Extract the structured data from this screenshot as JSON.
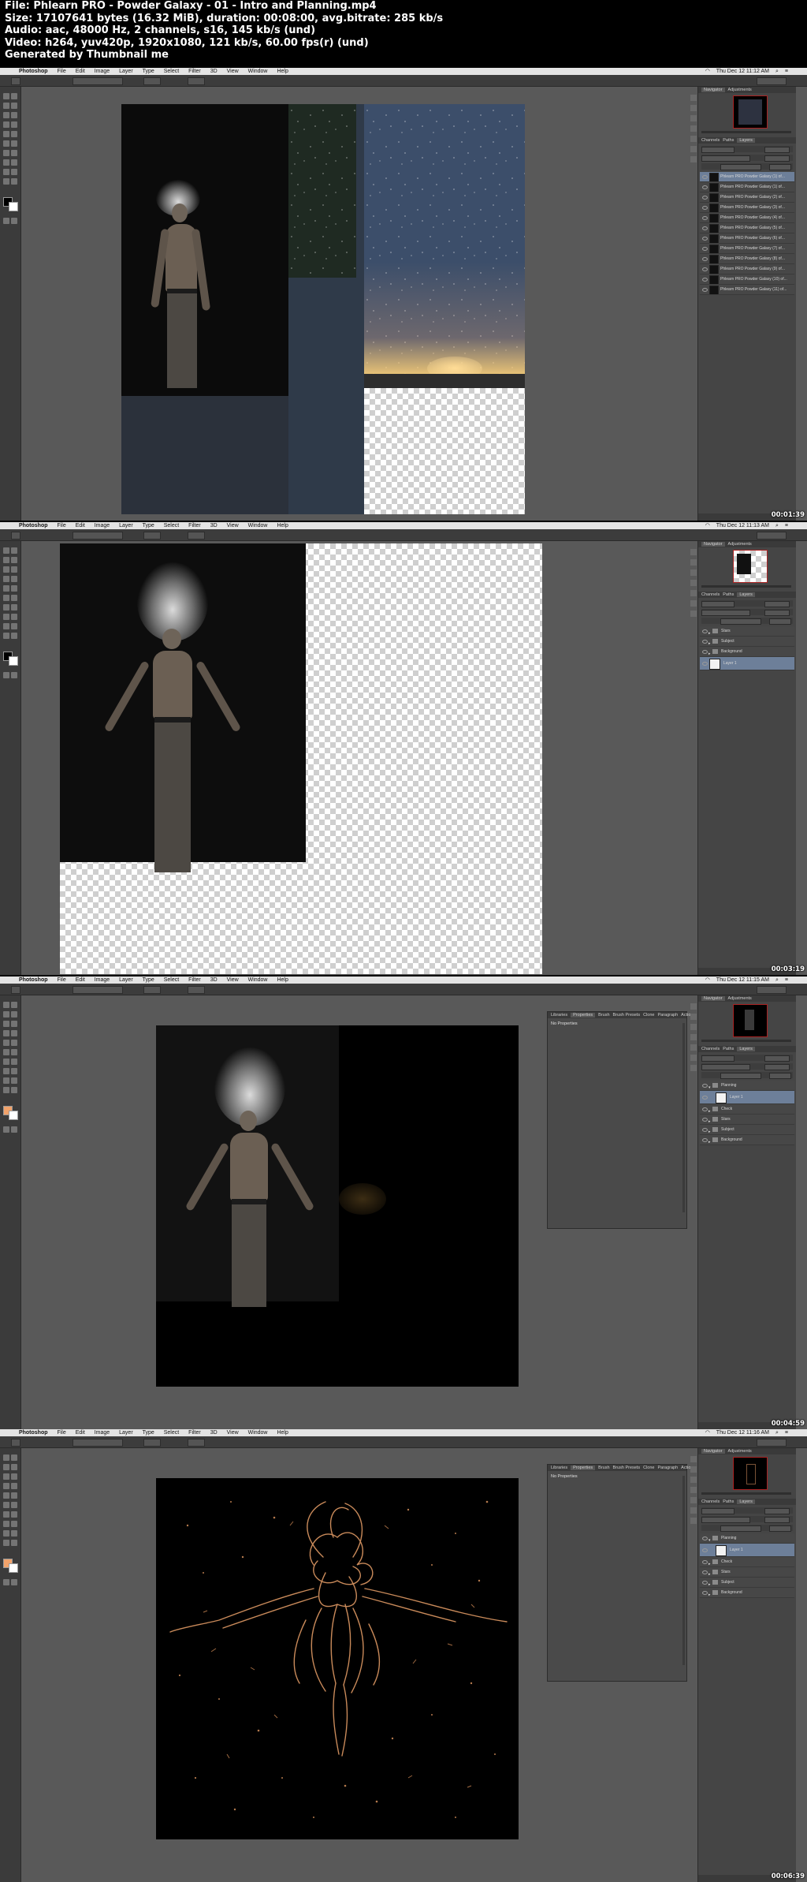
{
  "header": {
    "file": "File: Phlearn PRO - Powder Galaxy - 01 - Intro and Planning.mp4",
    "size": "Size: 17107641 bytes (16.32 MiB), duration: 00:08:00, avg.bitrate: 285 kb/s",
    "audio": "Audio: aac, 48000 Hz, 2 channels, s16, 145 kb/s (und)",
    "video": "Video: h264, yuv420p, 1920x1080, 121 kb/s, 60.00 fps(r) (und)",
    "generator": "Generated by Thumbnail me"
  },
  "menubar": {
    "app": "Photoshop",
    "items": [
      "File",
      "Edit",
      "Image",
      "Layer",
      "Type",
      "Select",
      "Filter",
      "3D",
      "View",
      "Window",
      "Help"
    ]
  },
  "navigator_tabs": [
    "Navigator",
    "Adjustments"
  ],
  "layers_tabs": [
    "Channels",
    "Paths",
    "Layers"
  ],
  "properties_tabs": [
    "Libraries",
    "Properties",
    "Brush",
    "Brush Presets",
    "Clone",
    "Paragraph",
    "Actions"
  ],
  "no_properties": "No Properties",
  "frames": [
    {
      "time": "Thu Dec 12  11:12 AM",
      "timestamp": "00:01:39",
      "layers": [
        "Phlearn PRO Powder Galaxy (1) of...",
        "Phlearn PRO Powder Galaxy (1) of...",
        "Phlearn PRO Powder Galaxy (2) of...",
        "Phlearn PRO Powder Galaxy (3) of...",
        "Phlearn PRO Powder Galaxy (4) of...",
        "Phlearn PRO Powder Galaxy (5) of...",
        "Phlearn PRO Powder Galaxy (6) of...",
        "Phlearn PRO Powder Galaxy (7) of...",
        "Phlearn PRO Powder Galaxy (8) of...",
        "Phlearn PRO Powder Galaxy (9) of...",
        "Phlearn PRO Powder Galaxy (10) of...",
        "Phlearn PRO Powder Galaxy (11) of..."
      ]
    },
    {
      "time": "Thu Dec 12  11:13 AM",
      "timestamp": "00:03:19",
      "layers": [
        "Stars",
        "Subject",
        "Background",
        "Layer 1"
      ]
    },
    {
      "time": "Thu Dec 12  11:15 AM",
      "timestamp": "00:04:59",
      "layers": [
        "Planning",
        "Layer 1",
        "Check",
        "Stars",
        "Subject",
        "Background"
      ]
    },
    {
      "time": "Thu Dec 12  11:16 AM",
      "timestamp": "00:06:39",
      "layers": [
        "Planning",
        "Layer 1",
        "Check",
        "Stars",
        "Subject",
        "Background"
      ]
    }
  ]
}
